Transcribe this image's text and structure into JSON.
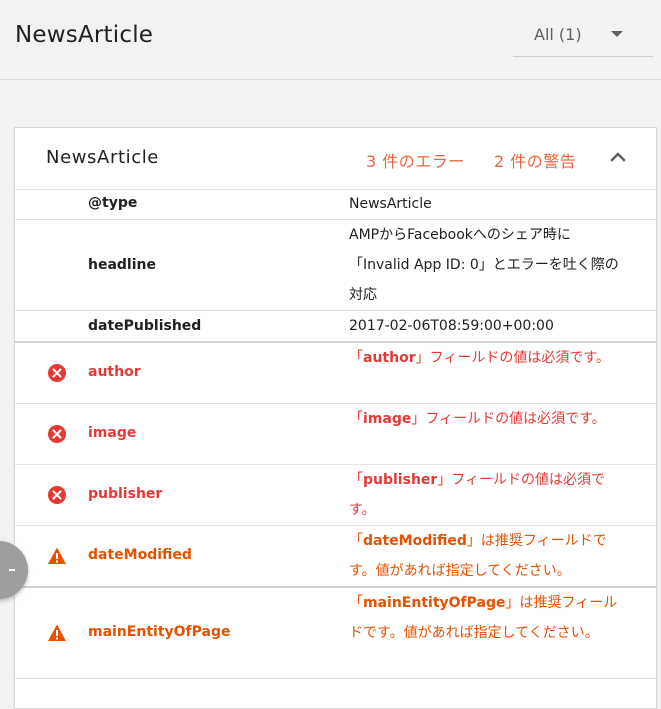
{
  "header": {
    "title": "NewsArticle",
    "filter_label": "All (1)"
  },
  "card": {
    "title": "NewsArticle",
    "error_summary": "3 件のエラー",
    "warning_summary": "2 件の警告"
  },
  "rows": [
    {
      "status": "ok",
      "key": "@type",
      "value_html": "NewsArticle"
    },
    {
      "status": "ok",
      "key": "headline",
      "value_html": "AMPからFacebookへのシェア時に「Invalid App ID: 0」とエラーを吐く際の対応"
    },
    {
      "status": "ok",
      "key": "datePublished",
      "value_html": "2017-02-06T08:59:00+00:00"
    },
    {
      "status": "error",
      "key": "author",
      "value_prefix": "「",
      "value_bold": "author",
      "value_suffix": "」フィールドの値は必須です。"
    },
    {
      "status": "error",
      "key": "image",
      "value_prefix": "「",
      "value_bold": "image",
      "value_suffix": "」フィールドの値は必須です。"
    },
    {
      "status": "error",
      "key": "publisher",
      "value_prefix": "「",
      "value_bold": "publisher",
      "value_suffix": "」フィールドの値は必須です。"
    },
    {
      "status": "warning",
      "key": "dateModified",
      "value_prefix": "「",
      "value_bold": "dateModified",
      "value_suffix": "」は推奨フィールドです。値があれば指定してください。"
    },
    {
      "status": "warning",
      "key": "mainEntityOfPage",
      "value_prefix": "「",
      "value_bold": "mainEntityOfPage",
      "value_suffix": "」は推奨フィールドです。値があれば指定してください。"
    }
  ],
  "colors": {
    "error": "#e53935",
    "warning": "#e65100",
    "summary_accent": "#e8663d"
  },
  "icons": {
    "collapse": "chevron-up-icon",
    "filter": "caret-down-icon",
    "error": "error-circle-icon",
    "warning": "warning-triangle-icon"
  }
}
